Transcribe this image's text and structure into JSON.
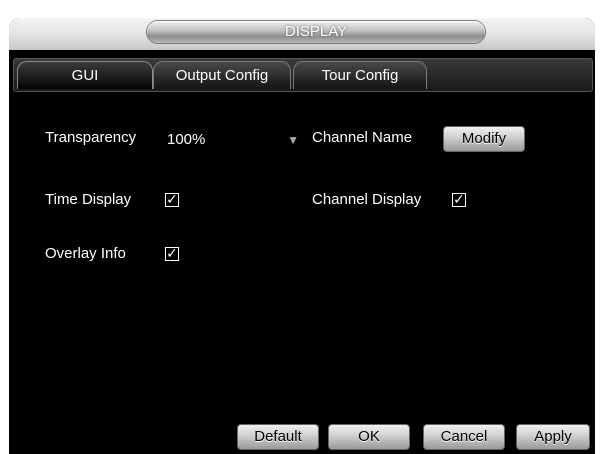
{
  "dialog": {
    "title": "DISPLAY"
  },
  "tabs": [
    {
      "label": "GUI",
      "active": true
    },
    {
      "label": "Output Config",
      "active": false
    },
    {
      "label": "Tour Config",
      "active": false
    }
  ],
  "gui": {
    "transparency_label": "Transparency",
    "transparency_value": "100%",
    "channel_name_label": "Channel Name",
    "modify_button": "Modify",
    "time_display_label": "Time Display",
    "time_display_checked": true,
    "channel_display_label": "Channel Display",
    "channel_display_checked": true,
    "overlay_info_label": "Overlay Info",
    "overlay_info_checked": true,
    "check_glyph": "✓"
  },
  "footer": {
    "default_label": "Default",
    "ok_label": "OK",
    "cancel_label": "Cancel",
    "apply_label": "Apply"
  }
}
